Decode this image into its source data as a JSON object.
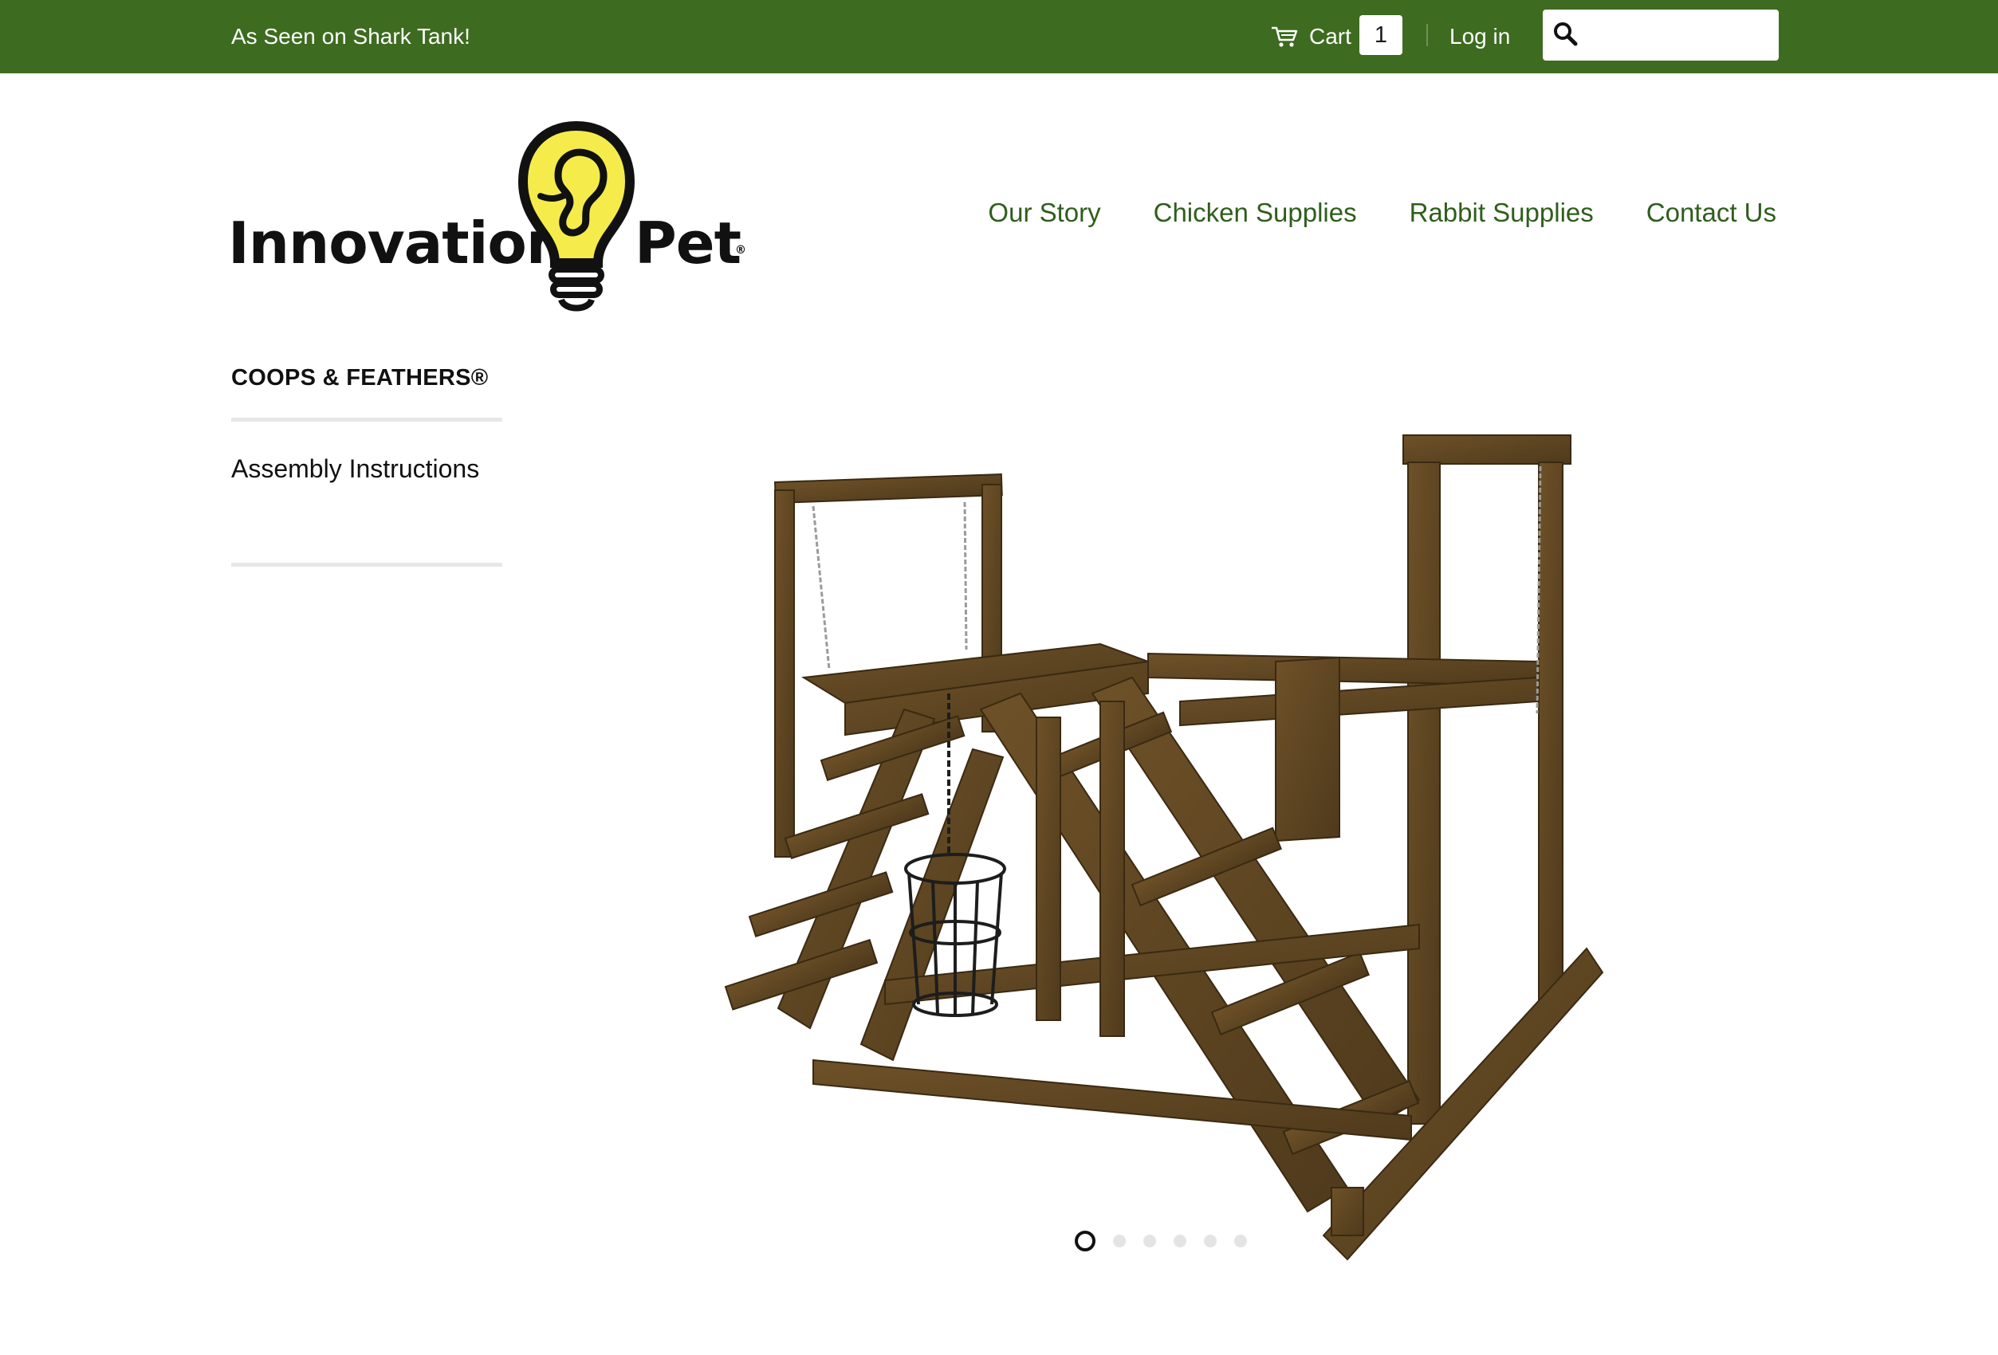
{
  "topbar": {
    "tagline": "As Seen on Shark Tank!",
    "cart_label": "Cart",
    "cart_count": "1",
    "login_label": "Log in",
    "search": {
      "placeholder": "",
      "value": ""
    }
  },
  "header": {
    "logo_alt": "Innovation Pet",
    "logo_left": "Innovation",
    "logo_right": "Pet",
    "logo_reg": "®",
    "nav": [
      {
        "label": "Our Story"
      },
      {
        "label": "Chicken Supplies"
      },
      {
        "label": "Rabbit Supplies"
      },
      {
        "label": "Contact Us"
      }
    ]
  },
  "sidebar": {
    "title": "COOPS & FEATHERS®",
    "links": [
      {
        "label": "Assembly Instructions"
      }
    ]
  },
  "slideshow": {
    "image_alt": "Wooden chicken play gym with swing, ladders and hanging treat basket",
    "current_slide": 1,
    "total_slides": 6
  },
  "colors": {
    "topbar": "#3d6b1f",
    "nav_link": "#2f5e1c",
    "wood": "#5c4320",
    "logo_yellow": "#f5ec4c"
  }
}
